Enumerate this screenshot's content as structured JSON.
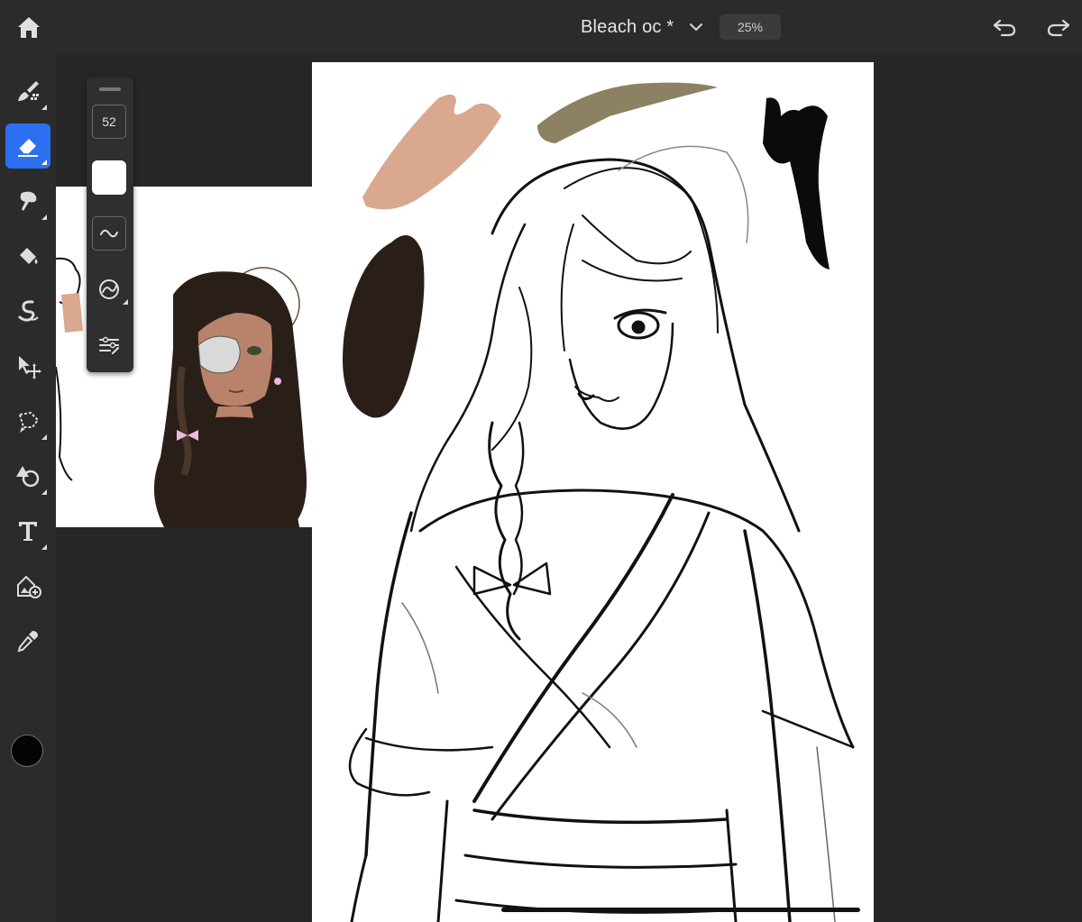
{
  "header": {
    "doc_title": "Bleach oc *",
    "zoom": "25%",
    "icons": [
      "home-icon",
      "chevron-down-icon",
      "undo-icon",
      "redo-icon"
    ]
  },
  "toolbar": {
    "tools": [
      {
        "name": "pixel-brush",
        "icon": "pixel-brush-icon",
        "active": false
      },
      {
        "name": "eraser",
        "icon": "eraser-icon",
        "active": true
      },
      {
        "name": "smudge",
        "icon": "smudge-icon",
        "active": false
      },
      {
        "name": "paint-bucket",
        "icon": "paint-bucket-icon",
        "active": false
      },
      {
        "name": "liquify",
        "icon": "liquify-icon",
        "active": false
      },
      {
        "name": "move",
        "icon": "move-icon",
        "active": false
      },
      {
        "name": "lasso",
        "icon": "lasso-icon",
        "active": false
      },
      {
        "name": "shapes",
        "icon": "shapes-icon",
        "active": false
      },
      {
        "name": "type",
        "icon": "type-icon",
        "active": false
      },
      {
        "name": "place-image",
        "icon": "place-image-icon",
        "active": false
      },
      {
        "name": "eyedropper",
        "icon": "eyedropper-icon",
        "active": false
      }
    ],
    "current_color": "#050505",
    "accent_color": "#2c6ff0"
  },
  "brush_panel": {
    "size": "52",
    "opacity_color": "#ffffff",
    "icons": [
      "smoothing-icon",
      "brush-settings-icon",
      "adjust-sliders-icon"
    ]
  },
  "canvas": {
    "swatches": [
      "#d9a88e",
      "#8c8163",
      "#2a1e19",
      "#0b0b0b"
    ]
  }
}
